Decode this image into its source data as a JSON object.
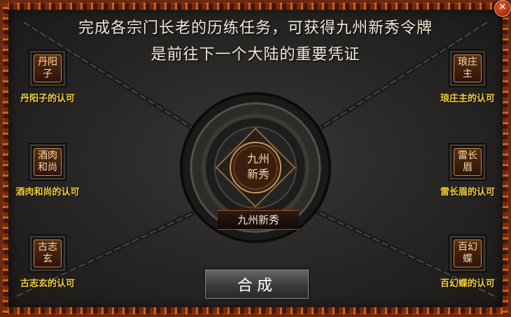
{
  "title": {
    "line1": "完成各宗门长老的历练任务，可获得九州新秀令牌",
    "line2": "是前往下一个大陆的重要凭证"
  },
  "close_label": "✕",
  "elders": [
    {
      "name": "丹阳子",
      "label": "丹阳子的认可"
    },
    {
      "name": "酒肉和尚",
      "label": "酒肉和尚的认可"
    },
    {
      "name": "古志玄",
      "label": "古志玄的认可"
    },
    {
      "name": "琅庄主",
      "label": "琅庄主的认可"
    },
    {
      "name": "雷长眉",
      "label": "雷长眉的认可"
    },
    {
      "name": "百幻蝶",
      "label": "百幻蝶的认可"
    }
  ],
  "token": {
    "name": "九州新秀",
    "label": "九州新秀"
  },
  "compose_button": "合成",
  "colors": {
    "label_gold": "#f5cf3e",
    "border_fire": "#c2531a"
  }
}
